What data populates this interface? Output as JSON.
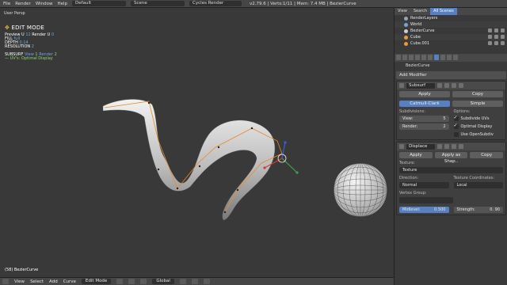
{
  "topbar": {
    "menus": [
      "File",
      "Render",
      "Window",
      "Help"
    ],
    "layout": "Default",
    "scene": "Scene",
    "engine": "Cycles Render",
    "stats": "v2.79.6 | Verts:1/11 | Mem: 7.4 MB | BezierCurve"
  },
  "viewport": {
    "title": "User Persp",
    "mode": "EDIT MODE",
    "overlay": {
      "preview_label": "Preview U",
      "preview_u": "12",
      "render_label": "Render U",
      "render_u": "0",
      "fill_label": "FILL",
      "fill_val": "full",
      "depth_label": "DEPTH",
      "depth_val": "0.14",
      "resolution_label": "RESOLUTION",
      "resolution_val": "2",
      "subsurf_label": "SUBSURF",
      "view_label": "View",
      "view_val": "1",
      "render2_label": "Render",
      "render2_val": "2",
      "uvs_label": "— UV's: Optimal Display"
    },
    "object_name": "(58) BezierCurve"
  },
  "bottombar": {
    "items": [
      "View",
      "Select",
      "Add",
      "Curve"
    ],
    "mode": "Edit Mode",
    "orientation": "Global"
  },
  "outliner": {
    "tabs": [
      "View",
      "Search",
      "All Scenes"
    ],
    "items": [
      "RenderLayers",
      "World",
      "BezierCurve",
      "Cube",
      "Cube.001"
    ]
  },
  "properties": {
    "breadcrumb": "BezierCurve",
    "add_modifier": "Add Modifier",
    "subsurf": {
      "name": "Subsurf",
      "apply": "Apply",
      "copy": "Copy",
      "type_a": "Catmull-Clark",
      "type_b": "Simple",
      "subdivisions_label": "Subdivisions:",
      "options_label": "Options:",
      "view_label": "View:",
      "view_val": "5",
      "render_label": "Render:",
      "render_val": "2",
      "opt1": "Subdivide UVs",
      "opt2": "Optimal Display",
      "opt3": "Use OpenSubdiv"
    },
    "displace": {
      "name": "Displace",
      "apply": "Apply",
      "apply_shape": "Apply as Shap..",
      "copy": "Copy",
      "texture_label": "Texture:",
      "texture_name": "Texture",
      "direction_label": "Direction:",
      "coords_label": "Texture Coordinates:",
      "direction_val": "Normal",
      "coords_val": "Local",
      "vgroup_label": "Vertex Group:",
      "midlevel_label": "Midlevel:",
      "midlevel_val": "0.500",
      "strength_label": "Strength:",
      "strength_val": "0. 90"
    }
  },
  "colors": {
    "accent": "#5680c2",
    "edit_orange": "#e88a2a",
    "overlay_blue": "#6aa7e6"
  }
}
